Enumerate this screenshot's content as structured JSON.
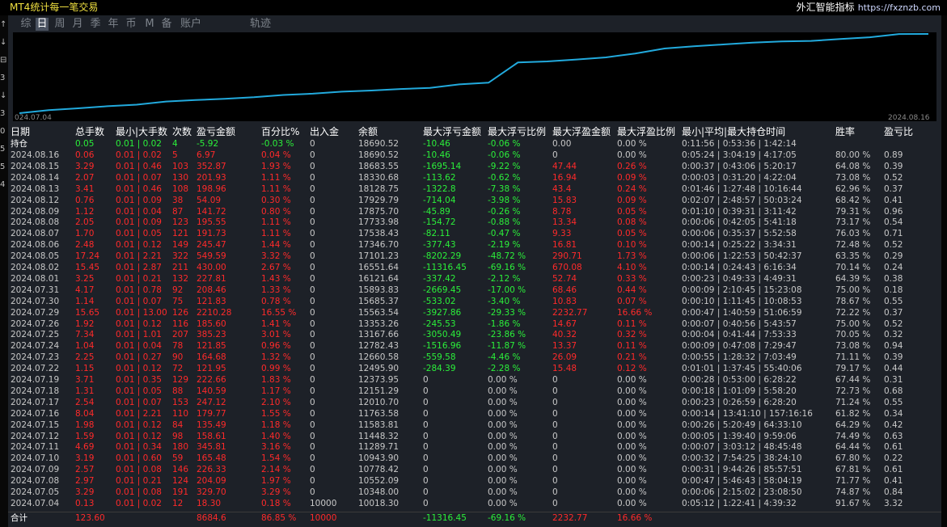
{
  "app_title": "MT4统计每一笔交易",
  "brand": {
    "name": "外汇智能指标",
    "url": "https://fxznzb.com"
  },
  "left_strip_text": [
    "↑",
    "↓",
    "⊟",
    "3",
    "↓",
    "3",
    "0",
    "5",
    "5",
    "4"
  ],
  "tabs": [
    {
      "label": "综",
      "active": false
    },
    {
      "label": "日",
      "active": true
    },
    {
      "label": "周",
      "active": false
    },
    {
      "label": "月",
      "active": false
    },
    {
      "label": "季",
      "active": false
    },
    {
      "label": "年",
      "active": false
    },
    {
      "label": "币",
      "active": false
    },
    {
      "label": "M",
      "active": false
    },
    {
      "label": "备",
      "active": false
    },
    {
      "label": "账户",
      "active": false
    },
    {
      "label": "轨迹",
      "active": false
    }
  ],
  "chart_data": {
    "type": "line",
    "x_start_label": "024.07.04",
    "x_end_label": "2024.08.16",
    "line_color": "#22aadd",
    "x": [
      "2024.07.04",
      "2024.07.05",
      "2024.07.08",
      "2024.07.09",
      "2024.07.10",
      "2024.07.11",
      "2024.07.12",
      "2024.07.15",
      "2024.07.16",
      "2024.07.17",
      "2024.07.18",
      "2024.07.19",
      "2024.07.22",
      "2024.07.23",
      "2024.07.24",
      "2024.07.25",
      "2024.07.26",
      "2024.07.29",
      "2024.07.30",
      "2024.07.31",
      "2024.08.01",
      "2024.08.02",
      "2024.08.05",
      "2024.08.06",
      "2024.08.07",
      "2024.08.08",
      "2024.08.09",
      "2024.08.12",
      "2024.08.13",
      "2024.08.14",
      "2024.08.15",
      "2024.08.16"
    ],
    "values": [
      10018.3,
      10348.0,
      10552.09,
      10778.42,
      10943.9,
      11289.71,
      11448.32,
      11583.81,
      11763.58,
      12010.7,
      12151.29,
      12373.95,
      12495.9,
      12660.58,
      12782.43,
      13167.66,
      13353.26,
      15563.54,
      15685.37,
      15893.83,
      16121.64,
      16551.64,
      17101.23,
      17346.7,
      17538.43,
      17733.98,
      17875.7,
      17929.79,
      18128.75,
      18330.68,
      18683.55,
      18690.52
    ]
  },
  "table": {
    "headers": [
      "日期",
      "总手数",
      "最小|大手数",
      "次数",
      "盈亏金额",
      "百分比%",
      "出入金",
      "余额",
      "最大浮亏金额",
      "最大浮亏比例",
      "最大浮盈金额",
      "最大浮盈比例",
      "最小|平均|最大持仓时间",
      "胜率",
      "盈亏比"
    ],
    "holding": {
      "label": "持仓",
      "lots": "0.05",
      "minmax": "0.01 | 0.02",
      "count": "4",
      "pnl": "-5.92",
      "pct": "-0.03 %",
      "flow": "0",
      "balance": "18690.52",
      "maxloss": "-10.46",
      "maxloss_pct": "-0.06 %",
      "maxprofit": "0.00",
      "maxprofit_pct": "0.00 %",
      "hold": "0:11:56 | 0:53:36 | 1:42:14",
      "win": "",
      "ratio": ""
    },
    "rows": [
      {
        "date": "2024.08.16",
        "lots": "0.06",
        "minmax": "0.01 | 0.02",
        "count": "5",
        "pnl": "6.97",
        "pct": "0.04 %",
        "flow": "0",
        "balance": "18690.52",
        "maxloss": "-10.46",
        "maxloss_pct": "-0.06 %",
        "maxprofit": "0",
        "maxprofit_pct": "0.00 %",
        "hold": "0:05:24 | 3:04:19 | 4:17:05",
        "win": "80.00 %",
        "ratio": "0.89"
      },
      {
        "date": "2024.08.15",
        "lots": "3.29",
        "minmax": "0.01 | 0.46",
        "count": "103",
        "pnl": "352.87",
        "pct": "1.93 %",
        "flow": "0",
        "balance": "18683.55",
        "maxloss": "-1695.14",
        "maxloss_pct": "-9.22 %",
        "maxprofit": "47.44",
        "maxprofit_pct": "0.26 %",
        "hold": "0:00:37 | 0:43:06 | 5:20:17",
        "win": "64.08 %",
        "ratio": "0.39"
      },
      {
        "date": "2024.08.14",
        "lots": "2.07",
        "minmax": "0.01 | 0.07",
        "count": "130",
        "pnl": "201.93",
        "pct": "1.11 %",
        "flow": "0",
        "balance": "18330.68",
        "maxloss": "-113.62",
        "maxloss_pct": "-0.62 %",
        "maxprofit": "16.94",
        "maxprofit_pct": "0.09 %",
        "hold": "0:00:03 | 0:31:20 | 4:22:04",
        "win": "73.08 %",
        "ratio": "0.52"
      },
      {
        "date": "2024.08.13",
        "lots": "3.41",
        "minmax": "0.01 | 0.46",
        "count": "108",
        "pnl": "198.96",
        "pct": "1.11 %",
        "flow": "0",
        "balance": "18128.75",
        "maxloss": "-1322.8",
        "maxloss_pct": "-7.38 %",
        "maxprofit": "43.4",
        "maxprofit_pct": "0.24 %",
        "hold": "0:01:46 | 1:27:48 | 10:16:44",
        "win": "62.96 %",
        "ratio": "0.37"
      },
      {
        "date": "2024.08.12",
        "lots": "0.76",
        "minmax": "0.01 | 0.09",
        "count": "38",
        "pnl": "54.09",
        "pct": "0.30 %",
        "flow": "0",
        "balance": "17929.79",
        "maxloss": "-714.04",
        "maxloss_pct": "-3.98 %",
        "maxprofit": "15.83",
        "maxprofit_pct": "0.09 %",
        "hold": "0:02:07 | 2:48:57 | 50:03:24",
        "win": "68.42 %",
        "ratio": "0.41"
      },
      {
        "date": "2024.08.09",
        "lots": "1.12",
        "minmax": "0.01 | 0.04",
        "count": "87",
        "pnl": "141.72",
        "pct": "0.80 %",
        "flow": "0",
        "balance": "17875.70",
        "maxloss": "-45.89",
        "maxloss_pct": "-0.26 %",
        "maxprofit": "8.78",
        "maxprofit_pct": "0.05 %",
        "hold": "0:01:10 | 0:39:31 | 3:11:42",
        "win": "79.31 %",
        "ratio": "0.96"
      },
      {
        "date": "2024.08.08",
        "lots": "2.05",
        "minmax": "0.01 | 0.09",
        "count": "123",
        "pnl": "195.55",
        "pct": "1.11 %",
        "flow": "0",
        "balance": "17733.98",
        "maxloss": "-154.72",
        "maxloss_pct": "-0.88 %",
        "maxprofit": "13.34",
        "maxprofit_pct": "0.08 %",
        "hold": "0:00:06 | 0:42:05 | 5:41:18",
        "win": "73.17 %",
        "ratio": "0.54"
      },
      {
        "date": "2024.08.07",
        "lots": "1.70",
        "minmax": "0.01 | 0.05",
        "count": "121",
        "pnl": "191.73",
        "pct": "1.11 %",
        "flow": "0",
        "balance": "17538.43",
        "maxloss": "-82.11",
        "maxloss_pct": "-0.47 %",
        "maxprofit": "9.33",
        "maxprofit_pct": "0.05 %",
        "hold": "0:00:06 | 0:35:37 | 5:52:58",
        "win": "76.03 %",
        "ratio": "0.71"
      },
      {
        "date": "2024.08.06",
        "lots": "2.48",
        "minmax": "0.01 | 0.12",
        "count": "149",
        "pnl": "245.47",
        "pct": "1.44 %",
        "flow": "0",
        "balance": "17346.70",
        "maxloss": "-377.43",
        "maxloss_pct": "-2.19 %",
        "maxprofit": "16.81",
        "maxprofit_pct": "0.10 %",
        "hold": "0:00:14 | 0:25:22 | 3:34:31",
        "win": "72.48 %",
        "ratio": "0.52"
      },
      {
        "date": "2024.08.05",
        "lots": "17.24",
        "minmax": "0.01 | 2.21",
        "count": "322",
        "pnl": "549.59",
        "pct": "3.32 %",
        "flow": "0",
        "balance": "17101.23",
        "maxloss": "-8202.29",
        "maxloss_pct": "-48.72 %",
        "maxprofit": "290.71",
        "maxprofit_pct": "1.73 %",
        "hold": "0:00:06 | 1:22:53 | 50:42:37",
        "win": "63.35 %",
        "ratio": "0.29"
      },
      {
        "date": "2024.08.02",
        "lots": "15.45",
        "minmax": "0.01 | 2.87",
        "count": "211",
        "pnl": "430.00",
        "pct": "2.67 %",
        "flow": "0",
        "balance": "16551.64",
        "maxloss": "-11316.45",
        "maxloss_pct": "-69.16 %",
        "maxprofit": "670.08",
        "maxprofit_pct": "4.10 %",
        "hold": "0:00:14 | 0:24:43 | 6:16:34",
        "win": "70.14 %",
        "ratio": "0.24"
      },
      {
        "date": "2024.08.01",
        "lots": "3.25",
        "minmax": "0.01 | 0.21",
        "count": "132",
        "pnl": "227.81",
        "pct": "1.43 %",
        "flow": "0",
        "balance": "16121.64",
        "maxloss": "-337.42",
        "maxloss_pct": "-2.12 %",
        "maxprofit": "52.74",
        "maxprofit_pct": "0.33 %",
        "hold": "0:00:23 | 0:49:33 | 4:49:31",
        "win": "64.39 %",
        "ratio": "0.38"
      },
      {
        "date": "2024.07.31",
        "lots": "4.17",
        "minmax": "0.01 | 0.78",
        "count": "92",
        "pnl": "208.46",
        "pct": "1.33 %",
        "flow": "0",
        "balance": "15893.83",
        "maxloss": "-2669.45",
        "maxloss_pct": "-17.00 %",
        "maxprofit": "68.46",
        "maxprofit_pct": "0.44 %",
        "hold": "0:00:09 | 2:10:45 | 15:23:08",
        "win": "75.00 %",
        "ratio": "0.18"
      },
      {
        "date": "2024.07.30",
        "lots": "1.14",
        "minmax": "0.01 | 0.07",
        "count": "75",
        "pnl": "121.83",
        "pct": "0.78 %",
        "flow": "0",
        "balance": "15685.37",
        "maxloss": "-533.02",
        "maxloss_pct": "-3.40 %",
        "maxprofit": "10.83",
        "maxprofit_pct": "0.07 %",
        "hold": "0:00:10 | 1:11:45 | 10:08:53",
        "win": "78.67 %",
        "ratio": "0.55"
      },
      {
        "date": "2024.07.29",
        "lots": "15.65",
        "minmax": "0.01 | 13.00",
        "count": "126",
        "pnl": "2210.28",
        "pct": "16.55 %",
        "flow": "0",
        "balance": "15563.54",
        "maxloss": "-3927.86",
        "maxloss_pct": "-29.33 %",
        "maxprofit": "2232.77",
        "maxprofit_pct": "16.66 %",
        "hold": "0:00:47 | 1:40:59 | 51:06:59",
        "win": "72.22 %",
        "ratio": "0.37"
      },
      {
        "date": "2024.07.26",
        "lots": "1.92",
        "minmax": "0.01 | 0.12",
        "count": "116",
        "pnl": "185.60",
        "pct": "1.41 %",
        "flow": "0",
        "balance": "13353.26",
        "maxloss": "-245.53",
        "maxloss_pct": "-1.86 %",
        "maxprofit": "14.67",
        "maxprofit_pct": "0.11 %",
        "hold": "0:00:07 | 0:40:56 | 5:43:57",
        "win": "75.00 %",
        "ratio": "0.52"
      },
      {
        "date": "2024.07.25",
        "lots": "7.34",
        "minmax": "0.01 | 1.01",
        "count": "207",
        "pnl": "385.23",
        "pct": "3.01 %",
        "flow": "0",
        "balance": "13167.66",
        "maxloss": "-3050.49",
        "maxloss_pct": "-23.86 %",
        "maxprofit": "40.32",
        "maxprofit_pct": "0.32 %",
        "hold": "0:00:04 | 0:41:44 | 7:53:33",
        "win": "70.05 %",
        "ratio": "0.32"
      },
      {
        "date": "2024.07.24",
        "lots": "1.04",
        "minmax": "0.01 | 0.04",
        "count": "78",
        "pnl": "121.85",
        "pct": "0.96 %",
        "flow": "0",
        "balance": "12782.43",
        "maxloss": "-1516.96",
        "maxloss_pct": "-11.87 %",
        "maxprofit": "13.37",
        "maxprofit_pct": "0.11 %",
        "hold": "0:00:09 | 0:47:08 | 7:29:47",
        "win": "73.08 %",
        "ratio": "0.94"
      },
      {
        "date": "2024.07.23",
        "lots": "2.25",
        "minmax": "0.01 | 0.27",
        "count": "90",
        "pnl": "164.68",
        "pct": "1.32 %",
        "flow": "0",
        "balance": "12660.58",
        "maxloss": "-559.58",
        "maxloss_pct": "-4.46 %",
        "maxprofit": "26.09",
        "maxprofit_pct": "0.21 %",
        "hold": "0:00:55 | 1:28:32 | 7:03:49",
        "win": "71.11 %",
        "ratio": "0.39"
      },
      {
        "date": "2024.07.22",
        "lots": "1.15",
        "minmax": "0.01 | 0.12",
        "count": "72",
        "pnl": "121.95",
        "pct": "0.99 %",
        "flow": "0",
        "balance": "12495.90",
        "maxloss": "-284.39",
        "maxloss_pct": "-2.28 %",
        "maxprofit": "15.48",
        "maxprofit_pct": "0.12 %",
        "hold": "0:01:01 | 1:37:45 | 55:40:06",
        "win": "79.17 %",
        "ratio": "0.44"
      },
      {
        "date": "2024.07.19",
        "lots": "3.71",
        "minmax": "0.01 | 0.35",
        "count": "129",
        "pnl": "222.66",
        "pct": "1.83 %",
        "flow": "0",
        "balance": "12373.95",
        "maxloss": "0",
        "maxloss_pct": "0.00 %",
        "maxprofit": "0",
        "maxprofit_pct": "0.00 %",
        "hold": "0:00:28 | 0:53:00 | 6:28:22",
        "win": "67.44 %",
        "ratio": "0.31"
      },
      {
        "date": "2024.07.18",
        "lots": "1.31",
        "minmax": "0.01 | 0.05",
        "count": "88",
        "pnl": "140.59",
        "pct": "1.17 %",
        "flow": "0",
        "balance": "12151.29",
        "maxloss": "0",
        "maxloss_pct": "0.00 %",
        "maxprofit": "0",
        "maxprofit_pct": "0.00 %",
        "hold": "0:00:18 | 1:01:09 | 5:58:20",
        "win": "72.73 %",
        "ratio": "0.68"
      },
      {
        "date": "2024.07.17",
        "lots": "2.54",
        "minmax": "0.01 | 0.07",
        "count": "153",
        "pnl": "247.12",
        "pct": "2.10 %",
        "flow": "0",
        "balance": "12010.70",
        "maxloss": "0",
        "maxloss_pct": "0.00 %",
        "maxprofit": "0",
        "maxprofit_pct": "0.00 %",
        "hold": "0:00:23 | 0:26:59 | 6:28:20",
        "win": "71.24 %",
        "ratio": "0.55"
      },
      {
        "date": "2024.07.16",
        "lots": "8.04",
        "minmax": "0.01 | 2.21",
        "count": "110",
        "pnl": "179.77",
        "pct": "1.55 %",
        "flow": "0",
        "balance": "11763.58",
        "maxloss": "0",
        "maxloss_pct": "0.00 %",
        "maxprofit": "0",
        "maxprofit_pct": "0.00 %",
        "hold": "0:00:14 | 13:41:10 | 157:16:16",
        "win": "61.82 %",
        "ratio": "0.34"
      },
      {
        "date": "2024.07.15",
        "lots": "1.98",
        "minmax": "0.01 | 0.12",
        "count": "84",
        "pnl": "135.49",
        "pct": "1.18 %",
        "flow": "0",
        "balance": "11583.81",
        "maxloss": "0",
        "maxloss_pct": "0.00 %",
        "maxprofit": "0",
        "maxprofit_pct": "0.00 %",
        "hold": "0:00:26 | 5:20:49 | 64:33:10",
        "win": "64.29 %",
        "ratio": "0.42"
      },
      {
        "date": "2024.07.12",
        "lots": "1.59",
        "minmax": "0.01 | 0.12",
        "count": "98",
        "pnl": "158.61",
        "pct": "1.40 %",
        "flow": "0",
        "balance": "11448.32",
        "maxloss": "0",
        "maxloss_pct": "0.00 %",
        "maxprofit": "0",
        "maxprofit_pct": "0.00 %",
        "hold": "0:00:05 | 1:39:40 | 9:59:06",
        "win": "74.49 %",
        "ratio": "0.63"
      },
      {
        "date": "2024.07.11",
        "lots": "4.69",
        "minmax": "0.01 | 0.34",
        "count": "180",
        "pnl": "345.81",
        "pct": "3.16 %",
        "flow": "0",
        "balance": "11289.71",
        "maxloss": "0",
        "maxloss_pct": "0.00 %",
        "maxprofit": "0",
        "maxprofit_pct": "0.00 %",
        "hold": "0:00:07 | 3:03:12 | 48:45:48",
        "win": "64.44 %",
        "ratio": "0.61"
      },
      {
        "date": "2024.07.10",
        "lots": "3.19",
        "minmax": "0.01 | 0.60",
        "count": "59",
        "pnl": "165.48",
        "pct": "1.54 %",
        "flow": "0",
        "balance": "10943.90",
        "maxloss": "0",
        "maxloss_pct": "0.00 %",
        "maxprofit": "0",
        "maxprofit_pct": "0.00 %",
        "hold": "0:00:32 | 7:54:25 | 38:24:10",
        "win": "67.80 %",
        "ratio": "0.22"
      },
      {
        "date": "2024.07.09",
        "lots": "2.57",
        "minmax": "0.01 | 0.08",
        "count": "146",
        "pnl": "226.33",
        "pct": "2.14 %",
        "flow": "0",
        "balance": "10778.42",
        "maxloss": "0",
        "maxloss_pct": "0.00 %",
        "maxprofit": "0",
        "maxprofit_pct": "0.00 %",
        "hold": "0:00:31 | 9:44:26 | 85:57:51",
        "win": "67.81 %",
        "ratio": "0.61"
      },
      {
        "date": "2024.07.08",
        "lots": "2.97",
        "minmax": "0.01 | 0.21",
        "count": "124",
        "pnl": "204.09",
        "pct": "1.97 %",
        "flow": "0",
        "balance": "10552.09",
        "maxloss": "0",
        "maxloss_pct": "0.00 %",
        "maxprofit": "0",
        "maxprofit_pct": "0.00 %",
        "hold": "0:00:47 | 5:46:43 | 58:04:19",
        "win": "71.77 %",
        "ratio": "0.41"
      },
      {
        "date": "2024.07.05",
        "lots": "3.29",
        "minmax": "0.01 | 0.08",
        "count": "191",
        "pnl": "329.70",
        "pct": "3.29 %",
        "flow": "0",
        "balance": "10348.00",
        "maxloss": "0",
        "maxloss_pct": "0.00 %",
        "maxprofit": "0",
        "maxprofit_pct": "0.00 %",
        "hold": "0:00:06 | 2:15:02 | 23:08:50",
        "win": "74.87 %",
        "ratio": "0.84"
      },
      {
        "date": "2024.07.04",
        "lots": "0.13",
        "minmax": "0.01 | 0.02",
        "count": "12",
        "pnl": "18.30",
        "pct": "0.18 %",
        "flow": "10000",
        "balance": "10018.30",
        "maxloss": "0",
        "maxloss_pct": "0.00 %",
        "maxprofit": "0",
        "maxprofit_pct": "0.00 %",
        "hold": "0:05:12 | 1:22:41 | 4:39:32",
        "win": "91.67 %",
        "ratio": "3.32"
      }
    ],
    "total": {
      "label": "合计",
      "lots": "123.60",
      "pnl": "8684.6",
      "pct": "86.85 %",
      "flow": "10000",
      "maxloss": "-11316.45",
      "maxloss_pct": "-69.16 %",
      "maxprofit": "2232.77",
      "maxprofit_pct": "16.66 %"
    }
  },
  "colors": {
    "profit": "#ff2a2a",
    "loss": "#2bf03a",
    "neutral": "#c8c8c8",
    "line": "#22aadd"
  }
}
